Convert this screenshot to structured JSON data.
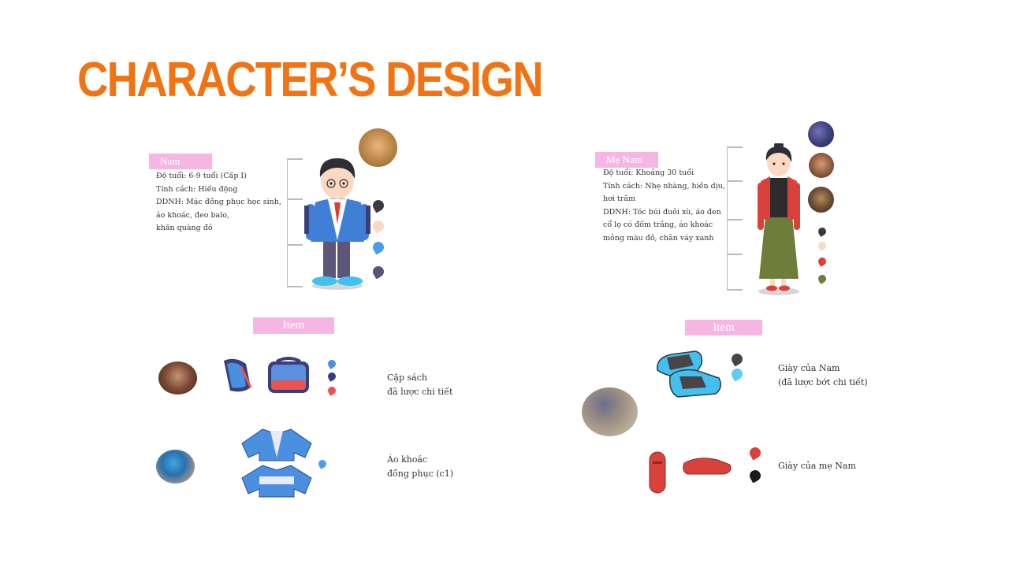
{
  "title": "CHARACTER’S DESIGN",
  "colors": {
    "title": "#f07314",
    "tag_bg": "#f6b6e3"
  },
  "nam": {
    "tag": "Nam",
    "age": "Độ tuổi: 6-9 tuổi (Cấp I)",
    "personality": "Tính cách: Hiếu động",
    "ddnh_1": "DDNH: Mặc đồng phục học sinh,",
    "ddnh_2": "áo khoác, đeo balo,",
    "ddnh_3": "khăn quàng đỏ",
    "palette": [
      "#3b3b3f",
      "#fbd9c2",
      "#4a9ee8",
      "#5b5277"
    ]
  },
  "me_nam": {
    "tag": "Mẹ Nam",
    "age": "Độ tuổi: Khoảng 30 tuổi",
    "personality_1": "Tính cách: Nhẹ nhàng, hiền dịu,",
    "personality_2": "hơi trầm",
    "ddnh_1": "DDNH: Tóc búi đuôi xù, áo đen",
    "ddnh_2": "cổ lọ có đốm trắng, áo khoác",
    "ddnh_3": "mỏng màu đỏ, chân váy xanh",
    "palette": [
      "#3a3a3a",
      "#fbd9c2",
      "#d9423b",
      "#6e7d3a"
    ]
  },
  "items_left": {
    "tag": "Item",
    "bag_label_1": "Cặp sách",
    "bag_label_2": "đã lược chi tiết",
    "bag_palette": [
      "#4a8fe0",
      "#3a3f7a",
      "#e8554e"
    ],
    "jacket_label_1": "Áo khoác",
    "jacket_label_2": "đồng phục (c1)",
    "jacket_palette": [
      "#4a9ee8"
    ]
  },
  "items_right": {
    "tag": "Item",
    "shoes_nam_1": "Giày của Nam",
    "shoes_nam_2": "(đã lược bớt chi tiết)",
    "shoes_nam_palette": [
      "#4a4446",
      "#5ccdf0"
    ],
    "shoes_me": "Giày của mẹ Nam",
    "shoes_me_palette": [
      "#d9423b",
      "#1a1a1a"
    ]
  }
}
